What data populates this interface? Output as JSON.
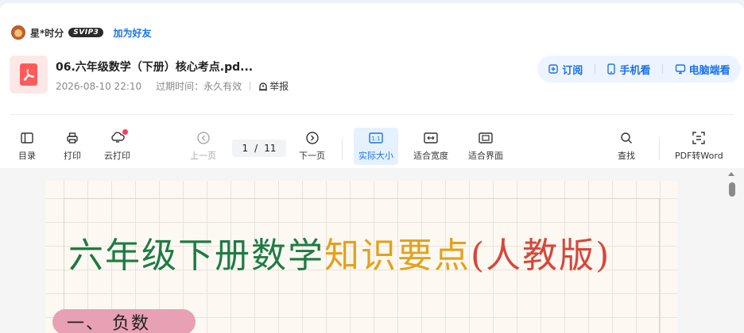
{
  "user": {
    "name": "星*时分",
    "vip": "SVIP3",
    "add_friend": "加为好友"
  },
  "file": {
    "title": "06.六年级数学（下册）核心考点.pd...",
    "date": "2026-08-10 22:10",
    "expiry": "过期时间：永久有效",
    "report": "举报"
  },
  "actions": {
    "subscribe": "订阅",
    "mobile": "手机看",
    "desktop": "电脑端看"
  },
  "toolbar": {
    "toc": "目录",
    "print": "打印",
    "cloud_print": "云打印",
    "prev": "上一页",
    "page_current": "1",
    "page_sep": "/",
    "page_total": "11",
    "next": "下一页",
    "actual": "实际大小",
    "fit_width": "适合宽度",
    "fit_page": "适合界面",
    "find": "查找",
    "pdf_word": "PDF转Word"
  },
  "document": {
    "title_part1": "六年级下册数学",
    "title_part2": "知识要点",
    "title_part3": "(人教版)",
    "section1": "一、 负数"
  },
  "colors": {
    "accent": "#1a73e8",
    "green": "#1e7b45",
    "yellow": "#e4a11b",
    "red": "#d8463a",
    "pink": "#e8a0b4"
  }
}
